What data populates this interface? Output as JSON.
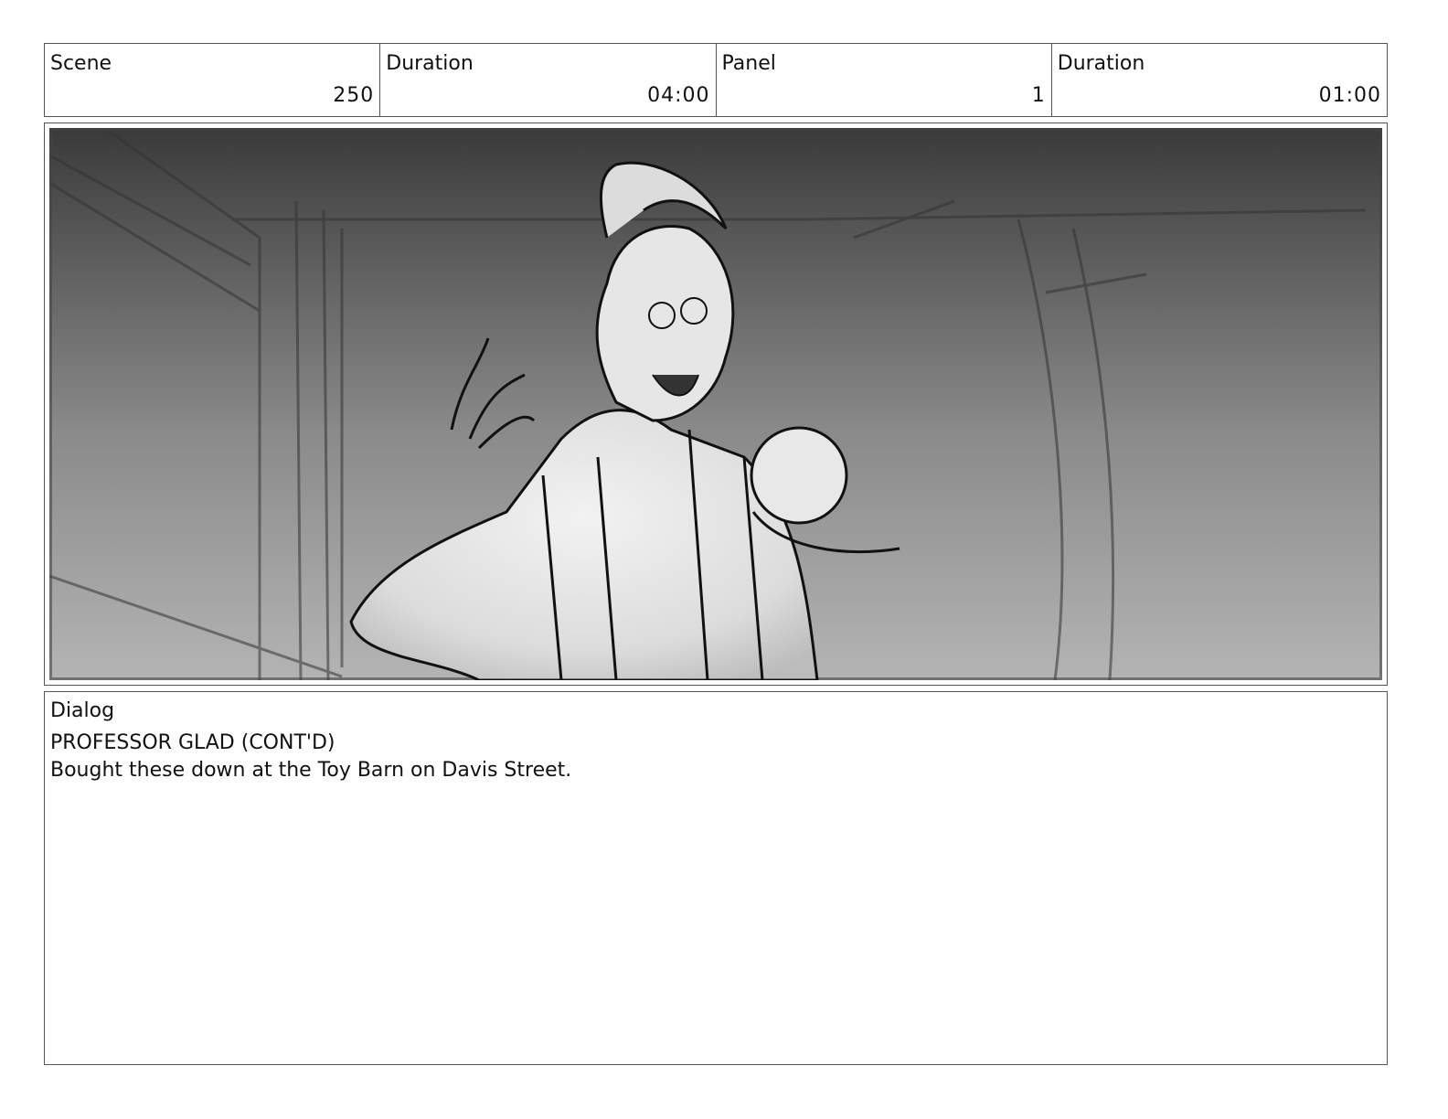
{
  "header": {
    "scene_label": "Scene",
    "scene_value": "250",
    "scene_duration_label": "Duration",
    "scene_duration_value": "04:00",
    "panel_label": "Panel",
    "panel_value": "1",
    "panel_duration_label": "Duration",
    "panel_duration_value": "01:00"
  },
  "dialog": {
    "label": "Dialog",
    "speaker": "PROFESSOR GLAD (CONT'D)",
    "line": "Bought these down at the Toy Barn on Davis Street."
  }
}
